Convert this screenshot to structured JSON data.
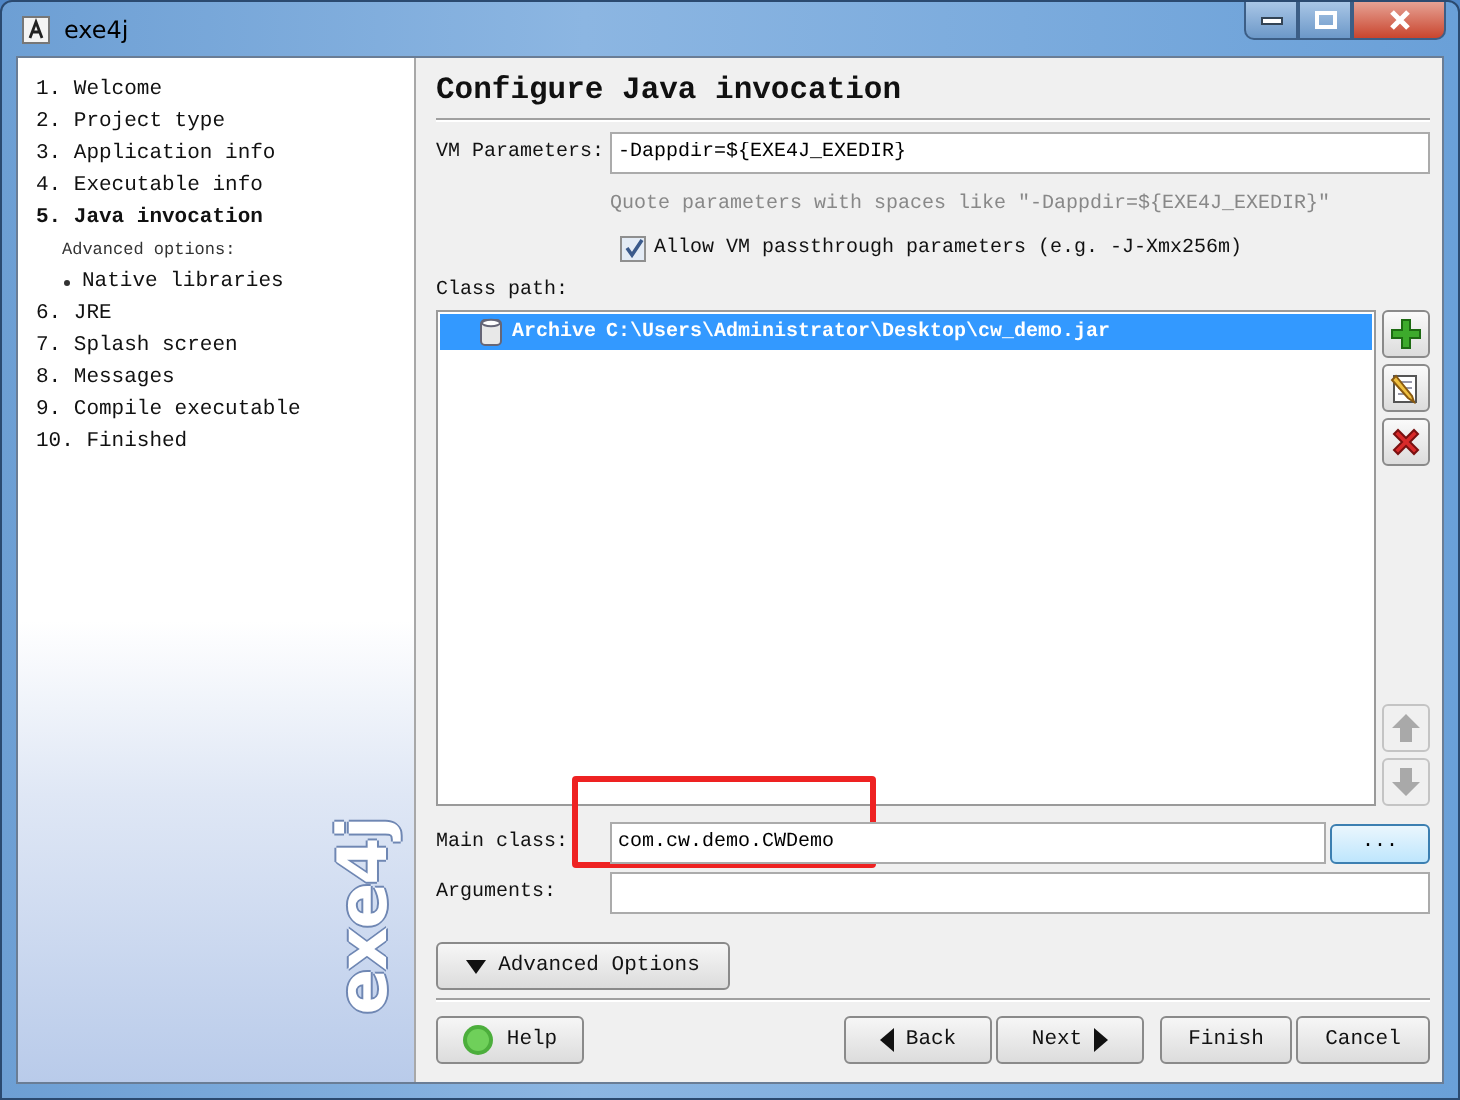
{
  "window": {
    "title": "exe4j"
  },
  "steps": [
    {
      "kind": "step",
      "label": "1. Welcome",
      "selected": false
    },
    {
      "kind": "step",
      "label": "2. Project type",
      "selected": false
    },
    {
      "kind": "step",
      "label": "3. Application info",
      "selected": false
    },
    {
      "kind": "step",
      "label": "4. Executable info",
      "selected": false
    },
    {
      "kind": "step",
      "label": "5. Java invocation",
      "selected": true
    },
    {
      "kind": "heading",
      "label": "Advanced options:"
    },
    {
      "kind": "substep",
      "label": "Native libraries",
      "selected": false
    },
    {
      "kind": "step",
      "label": "6. JRE",
      "selected": false
    },
    {
      "kind": "step",
      "label": "7. Splash screen",
      "selected": false
    },
    {
      "kind": "step",
      "label": "8. Messages",
      "selected": false
    },
    {
      "kind": "step",
      "label": "9. Compile executable",
      "selected": false
    },
    {
      "kind": "step",
      "label": "10. Finished",
      "selected": false
    }
  ],
  "logo": "exe4j",
  "page_title": "Configure Java invocation",
  "vm_parameters": {
    "label": "VM Parameters:",
    "value": "-Dappdir=${EXE4J_EXEDIR}"
  },
  "hint": "Quote parameters with spaces like \"-Dappdir=${EXE4J_EXEDIR}\"",
  "passthrough": {
    "label": "Allow VM passthrough parameters (e.g. -J-Xmx256m)",
    "checked": true
  },
  "class_path": {
    "label": "Class path:",
    "entries": [
      {
        "type": "Archive",
        "path": "C:\\Users\\Administrator\\Desktop\\cw_demo.jar",
        "selected": true
      }
    ],
    "tools": [
      {
        "kind": "add",
        "disabled": false
      },
      {
        "kind": "edit",
        "disabled": false
      },
      {
        "kind": "remove",
        "disabled": false
      },
      {
        "kind": "up",
        "disabled": true
      },
      {
        "kind": "down",
        "disabled": true
      }
    ]
  },
  "main_class": {
    "label": "Main class:",
    "value": "com.cw.demo.CWDemo",
    "browse": "..."
  },
  "arguments": {
    "label": "Arguments:"
  },
  "advanced_button": "Advanced Options",
  "buttons": [
    {
      "kind": "help",
      "label": "Help"
    },
    {
      "kind": "back",
      "label": "Back"
    },
    {
      "kind": "next",
      "label": "Next"
    },
    {
      "kind": "finish",
      "label": "Finish"
    },
    {
      "kind": "cancel",
      "label": "Cancel"
    }
  ]
}
